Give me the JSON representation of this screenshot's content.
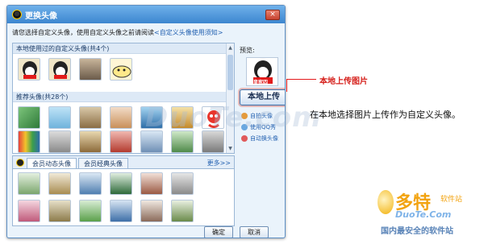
{
  "dialog": {
    "title": "更换头像",
    "close_label": "×",
    "intro_text": "请您选择自定义头像，使用自定义头像之前请阅读",
    "intro_link": "<自定义头像使用须知>",
    "section_recent": "本地使用过的自定义头像(共4个)",
    "section_recommended": "推荐头像(共28个)",
    "tab_dynamic": "会员动态头像",
    "tab_classic": "会员经典头像",
    "more_link": "更多>>",
    "ok_button": "确定",
    "cancel_button": "取消",
    "preview_label": "预览:",
    "upload_button": "本地上传",
    "side_links": [
      "自拍头像",
      "使用QQ秀",
      "自动换头像"
    ],
    "preview_badge": "皇家四"
  },
  "annotation": {
    "callout": "本地上传图片",
    "caption": "在本地选择图片上传作为自定义头像。"
  },
  "watermark": "DuoTe.com",
  "brand": {
    "name": "多特",
    "sub": "软件站",
    "domain": "DuoTe.Com",
    "tagline": "国内最安全的软件站"
  },
  "colors": {
    "accent": "#3c86cf",
    "callout": "#e3191b",
    "brand": "#f2a310"
  }
}
